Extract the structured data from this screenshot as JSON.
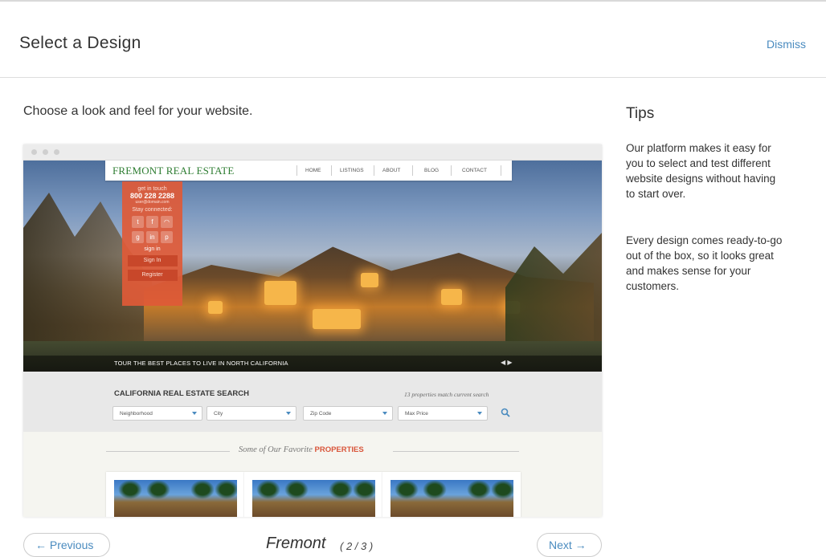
{
  "header": {
    "title": "Select a Design",
    "dismiss_label": "Dismiss"
  },
  "intro": "Choose a look and feel for your website.",
  "tips": {
    "title": "Tips",
    "paragraphs": [
      "Our platform makes it easy for you to select and test different website designs without having to start over.",
      "Every design comes ready-to-go out of the box, so it looks great and makes sense for your customers."
    ]
  },
  "preview": {
    "brand": "FREMONT REAL ESTATE",
    "nav": [
      "HOME",
      "LISTINGS",
      "ABOUT",
      "BLOG",
      "CONTACT"
    ],
    "contact": {
      "get_in_touch": "get in touch",
      "phone": "800 228 2288",
      "email": "user@domain.com",
      "stay_connected": "Stay connected:",
      "signin_heading": "sign in",
      "signin_button": "Sign In",
      "register_button": "Register"
    },
    "hero_caption": "TOUR THE BEST PLACES TO LIVE IN NORTH CALIFORNIA",
    "hero_arrows": "◀ ▶",
    "search": {
      "title": "CALIFORNIA REAL ESTATE SEARCH",
      "match_text": "13 properties match current search",
      "selects": [
        "Neighborhood",
        "City",
        "Zip Code",
        "Max Price"
      ]
    },
    "favorites": {
      "prefix": "Some of Our Favorite",
      "highlight": "PROPERTIES"
    }
  },
  "pager": {
    "prev_label": "← Previous",
    "next_label": "Next →",
    "design_name": "Fremont",
    "design_count": "( 2 / 3 )"
  }
}
